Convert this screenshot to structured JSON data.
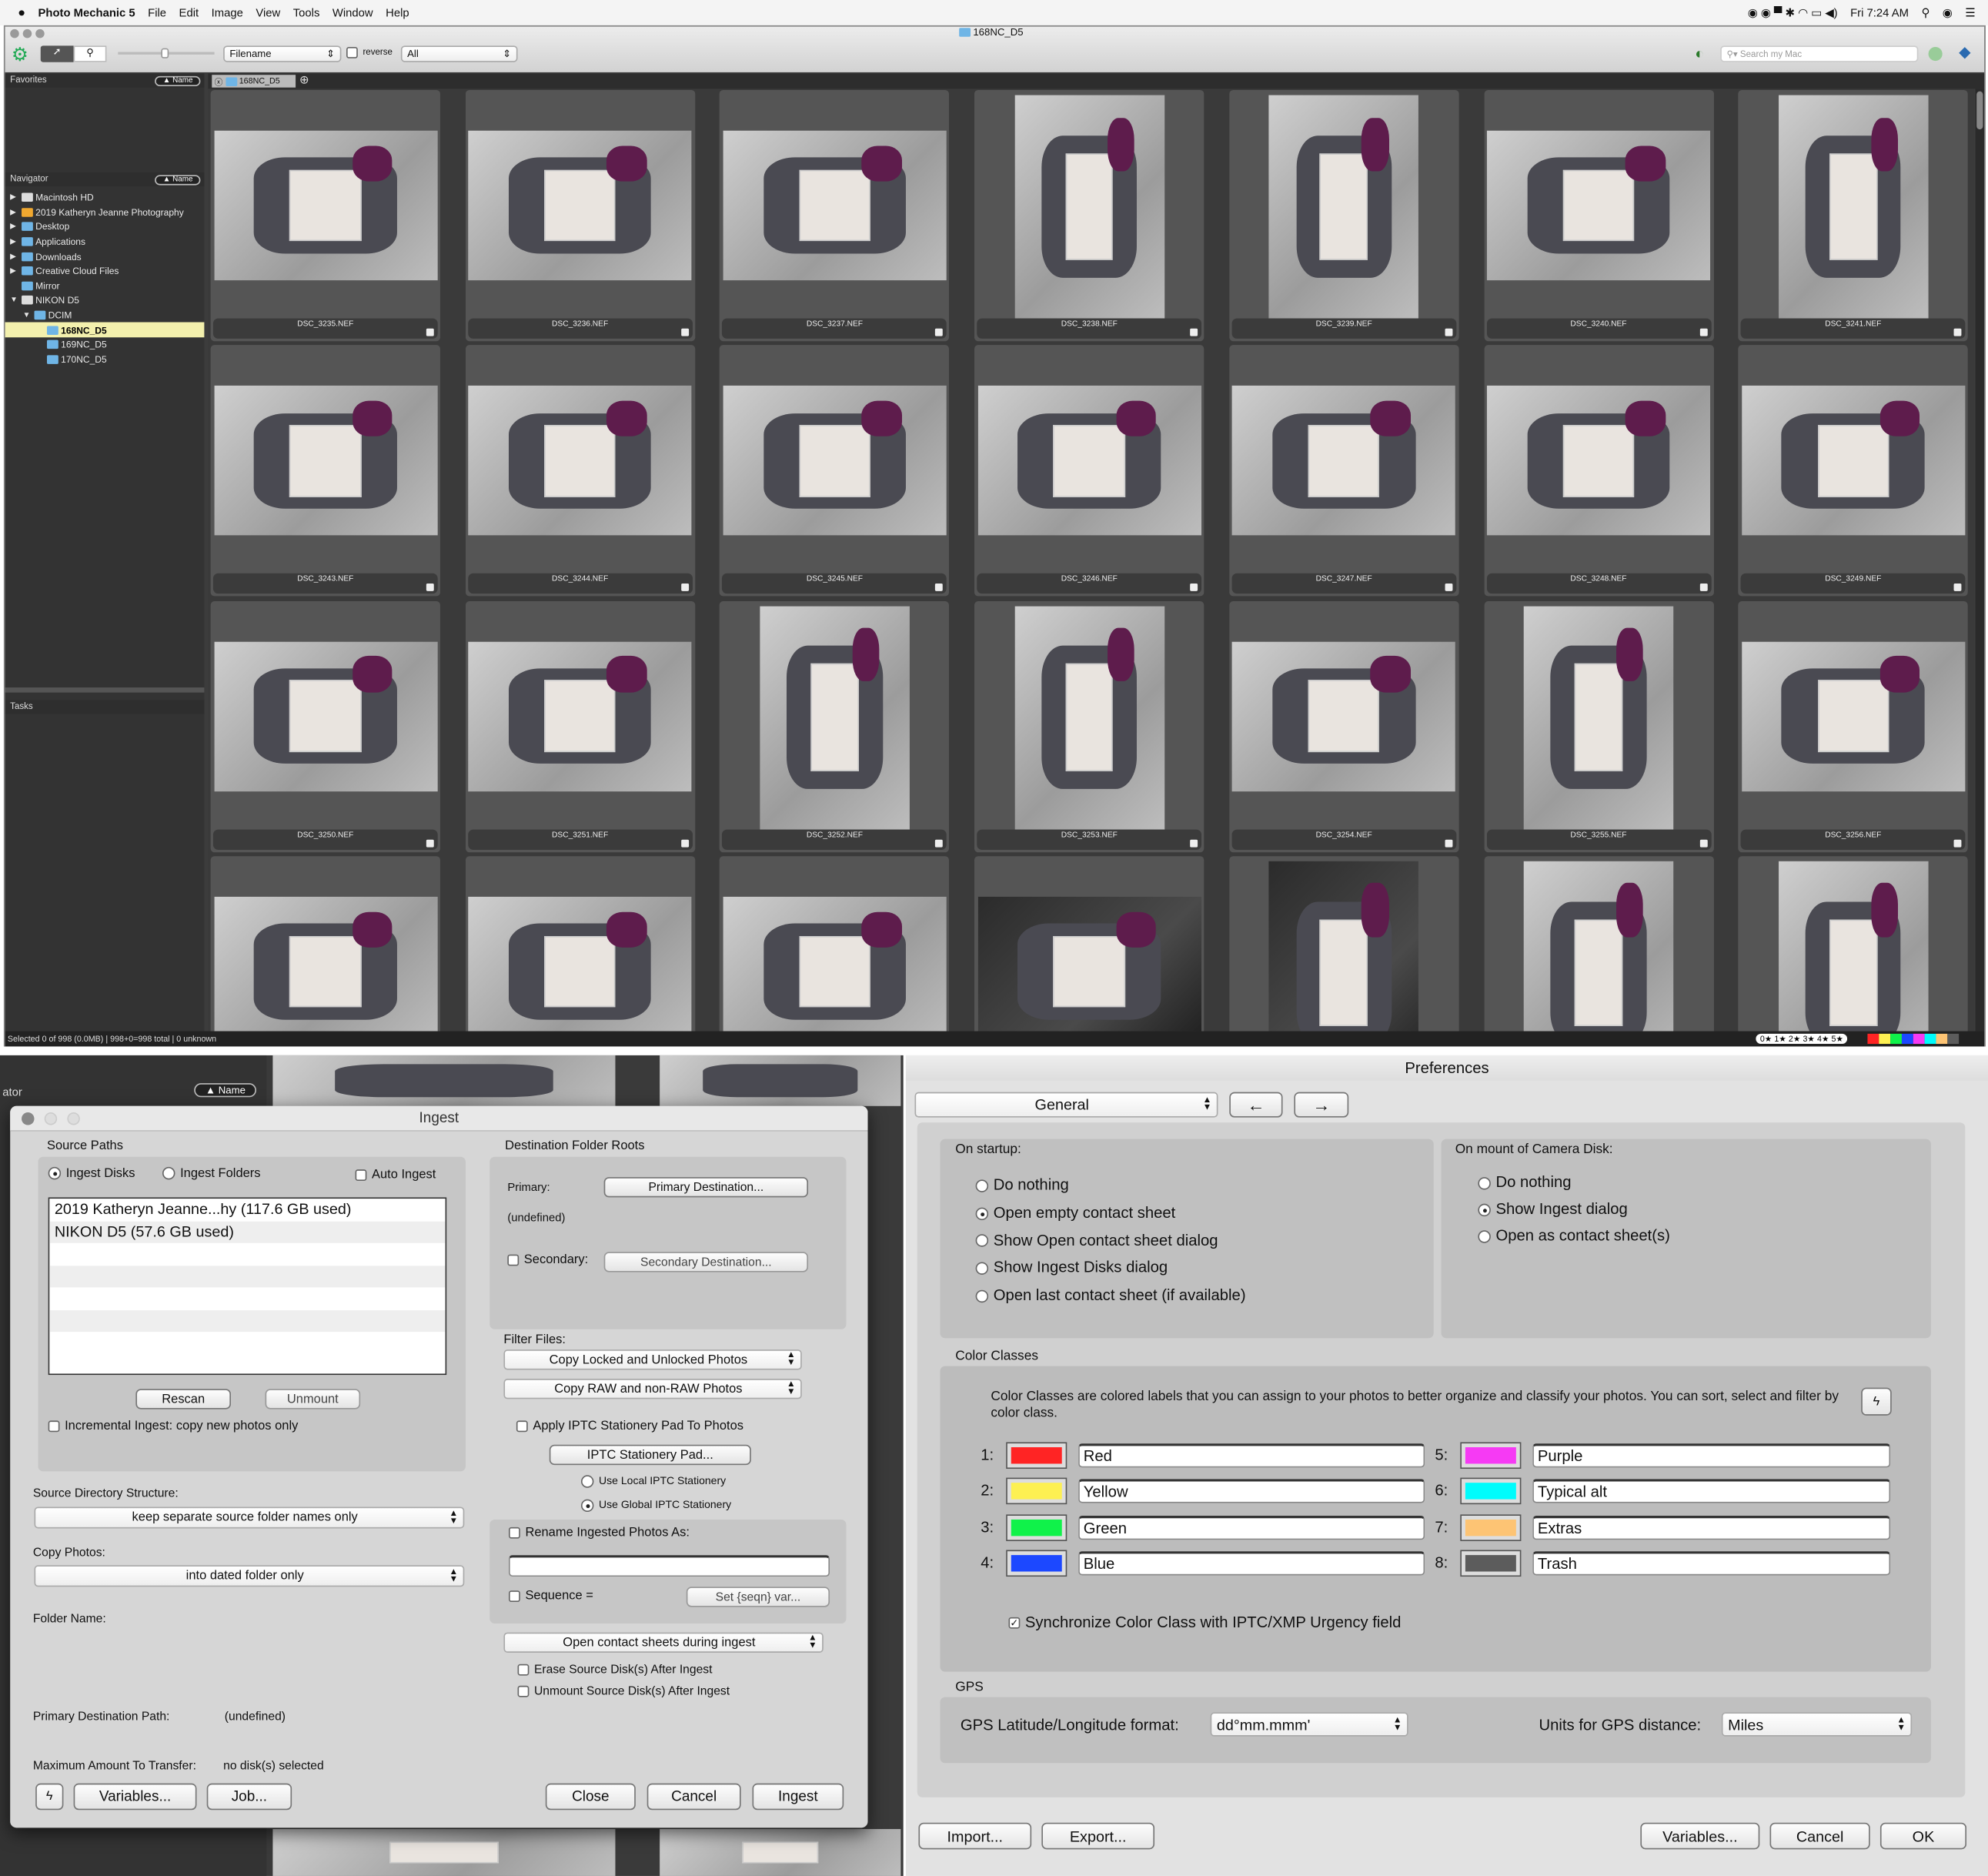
{
  "menubar": {
    "app": "Photo Mechanic 5",
    "items": [
      "File",
      "Edit",
      "Image",
      "View",
      "Tools",
      "Window",
      "Help"
    ],
    "clock": "Fri 7:24 AM"
  },
  "window": {
    "title": "168NC_D5"
  },
  "toolbar": {
    "sort_field": "Filename",
    "reverse_label": "reverse",
    "filter": "All",
    "search_placeholder": "Search my Mac"
  },
  "sidebar": {
    "favorites_label": "Favorites",
    "sort_label": "▲ Name",
    "navigator_label": "Navigator",
    "tasks_label": "Tasks",
    "tree": [
      {
        "label": "Macintosh HD",
        "depth": 0,
        "arrow": "▶",
        "icon": "hard-drive"
      },
      {
        "label": "2019 Katheryn Jeanne Photography",
        "depth": 0,
        "arrow": "▶",
        "icon": "external-drive"
      },
      {
        "label": "Desktop",
        "depth": 0,
        "arrow": "▶",
        "icon": "folder"
      },
      {
        "label": "Applications",
        "depth": 0,
        "arrow": "▶",
        "icon": "folder"
      },
      {
        "label": "Downloads",
        "depth": 0,
        "arrow": "▶",
        "icon": "folder"
      },
      {
        "label": "Creative Cloud Files",
        "depth": 0,
        "arrow": "▶",
        "icon": "folder"
      },
      {
        "label": "Mirror",
        "depth": 0,
        "arrow": "",
        "icon": "folder"
      },
      {
        "label": "NIKON D5",
        "depth": 0,
        "arrow": "▼",
        "icon": "disk"
      },
      {
        "label": "DCIM",
        "depth": 1,
        "arrow": "▼",
        "icon": "folder"
      },
      {
        "label": "168NC_D5",
        "depth": 2,
        "arrow": "",
        "icon": "folder",
        "selected": true
      },
      {
        "label": "169NC_D5",
        "depth": 2,
        "arrow": "",
        "icon": "folder"
      },
      {
        "label": "170NC_D5",
        "depth": 2,
        "arrow": "",
        "icon": "folder"
      }
    ]
  },
  "tab": {
    "label": "168NC_D5"
  },
  "photos": [
    {
      "name": "DSC_3235.NEF",
      "o": "L"
    },
    {
      "name": "DSC_3236.NEF",
      "o": "L"
    },
    {
      "name": "DSC_3237.NEF",
      "o": "L"
    },
    {
      "name": "DSC_3238.NEF",
      "o": "P"
    },
    {
      "name": "DSC_3239.NEF",
      "o": "P"
    },
    {
      "name": "DSC_3240.NEF",
      "o": "L"
    },
    {
      "name": "DSC_3241.NEF",
      "o": "P"
    },
    {
      "name": "DSC_3243.NEF",
      "o": "L"
    },
    {
      "name": "DSC_3244.NEF",
      "o": "L"
    },
    {
      "name": "DSC_3245.NEF",
      "o": "L"
    },
    {
      "name": "DSC_3246.NEF",
      "o": "L"
    },
    {
      "name": "DSC_3247.NEF",
      "o": "L"
    },
    {
      "name": "DSC_3248.NEF",
      "o": "L"
    },
    {
      "name": "DSC_3249.NEF",
      "o": "L"
    },
    {
      "name": "DSC_3250.NEF",
      "o": "L"
    },
    {
      "name": "DSC_3251.NEF",
      "o": "L"
    },
    {
      "name": "DSC_3252.NEF",
      "o": "P"
    },
    {
      "name": "DSC_3253.NEF",
      "o": "P"
    },
    {
      "name": "DSC_3254.NEF",
      "o": "L"
    },
    {
      "name": "DSC_3255.NEF",
      "o": "P"
    },
    {
      "name": "DSC_3256.NEF",
      "o": "L"
    },
    {
      "name": "",
      "o": "L"
    },
    {
      "name": "",
      "o": "L"
    },
    {
      "name": "",
      "o": "L"
    },
    {
      "name": "",
      "o": "L",
      "dark": true
    },
    {
      "name": "",
      "o": "P",
      "dark": true
    },
    {
      "name": "",
      "o": "P"
    },
    {
      "name": "",
      "o": "P"
    }
  ],
  "statusbar": {
    "text": "Selected 0 of 998 (0.0MB) | 998+0=998 total | 0 unknown",
    "stars": "0★ 1★ 2★ 3★ 4★ 5★"
  },
  "background": {
    "navigator_fragment": "ator",
    "sort_label": "▲ Name"
  },
  "ingest": {
    "title": "Ingest",
    "source_paths": "Source Paths",
    "ingest_disks": "Ingest Disks",
    "ingest_folders": "Ingest Folders",
    "auto_ingest": "Auto Ingest",
    "disks": [
      "2019 Katheryn Jeanne...hy   (117.6 GB used)",
      "NIKON D5   (57.6 GB used)"
    ],
    "rescan": "Rescan",
    "unmount": "Unmount",
    "incremental": "Incremental Ingest: copy new photos only",
    "source_dir_label": "Source Directory Structure:",
    "source_dir_value": "keep separate source folder names only",
    "copy_photos_label": "Copy Photos:",
    "copy_photos_value": "into dated folder only",
    "folder_name_label": "Folder Name:",
    "primary_path_label": "Primary Destination Path:",
    "primary_path_value": "(undefined)",
    "max_label": "Maximum Amount To Transfer:",
    "max_value": "no disk(s) selected",
    "dest_roots": "Destination Folder Roots",
    "primary_label": "Primary:",
    "primary_button": "Primary Destination...",
    "primary_value": "(undefined)",
    "secondary_label": "Secondary:",
    "secondary_button": "Secondary Destination...",
    "filter_label": "Filter Files:",
    "filter_lock": "Copy Locked and Unlocked Photos",
    "filter_raw": "Copy RAW and non-RAW Photos",
    "apply_iptc": "Apply IPTC Stationery Pad To Photos",
    "iptc_button": "IPTC Stationery Pad...",
    "use_local": "Use Local IPTC Stationery",
    "use_global": "Use Global IPTC Stationery",
    "rename_label": "Rename Ingested Photos As:",
    "rename_value": "",
    "sequence_label": "Sequence =",
    "seqn_button": "Set {seqn} var...",
    "open_contact": "Open contact sheets during ingest",
    "erase": "Erase Source Disk(s) After Ingest",
    "unmount_after": "Unmount Source Disk(s) After Ingest",
    "variables": "Variables...",
    "job": "Job...",
    "close": "Close",
    "cancel": "Cancel",
    "ingest": "Ingest"
  },
  "preferences": {
    "title": "Preferences",
    "section": "General",
    "back": "←",
    "forward": "→",
    "startup_label": "On startup:",
    "startup_options": [
      "Do nothing",
      "Open empty contact sheet",
      "Show Open contact sheet dialog",
      "Show Ingest Disks dialog",
      "Open last contact sheet (if available)"
    ],
    "startup_selected": 1,
    "mount_label": "On mount of Camera Disk:",
    "mount_options": [
      "Do nothing",
      "Show Ingest dialog",
      "Open as contact sheet(s)"
    ],
    "mount_selected": 1,
    "color_classes_label": "Color Classes",
    "color_description": "Color Classes are colored labels that you can assign to your photos to better organize and classify your photos.  You can sort, select and filter by color class.",
    "color_classes": [
      {
        "num": "1:",
        "name": "Red",
        "color": "#ff2424"
      },
      {
        "num": "2:",
        "name": "Yellow",
        "color": "#fdf052"
      },
      {
        "num": "3:",
        "name": "Green",
        "color": "#10f24a"
      },
      {
        "num": "4:",
        "name": "Blue",
        "color": "#1c48ff"
      },
      {
        "num": "5:",
        "name": "Purple",
        "color": "#f63af4"
      },
      {
        "num": "6:",
        "name": "Typical alt",
        "color": "#00fcfc"
      },
      {
        "num": "7:",
        "name": "Extras",
        "color": "#fdc474"
      },
      {
        "num": "8:",
        "name": "Trash",
        "color": "#5c5c5c"
      }
    ],
    "sync_label": "Synchronize Color Class with IPTC/XMP Urgency field",
    "sync_checked": true,
    "gps_label": "GPS",
    "gps_format_label": "GPS Latitude/Longitude format:",
    "gps_format_value": "dd°mm.mmm'",
    "gps_units_label": "Units for GPS distance:",
    "gps_units_value": "Miles",
    "import": "Import...",
    "export": "Export...",
    "variables": "Variables...",
    "cancel": "Cancel",
    "ok": "OK"
  }
}
